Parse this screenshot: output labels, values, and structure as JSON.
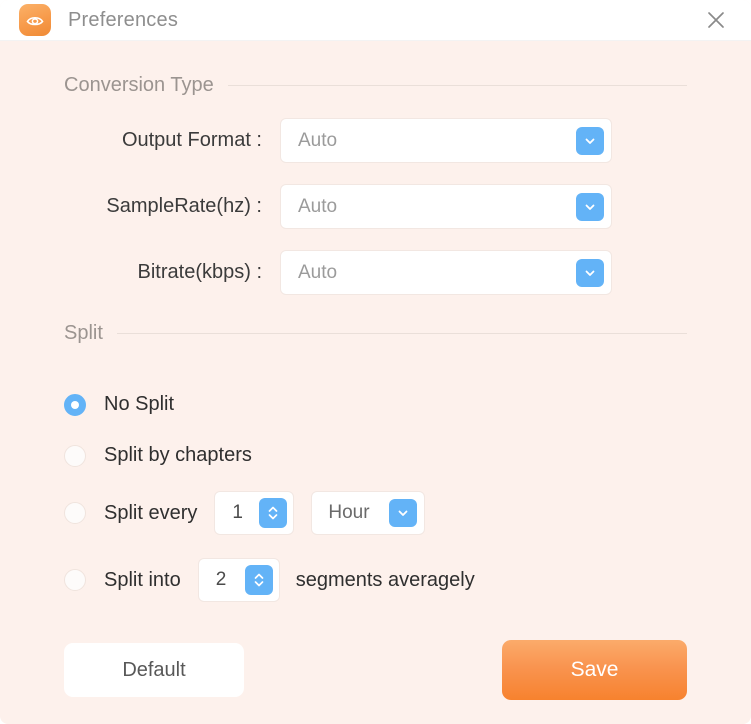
{
  "window": {
    "title": "Preferences",
    "app_icon": "eye-icon",
    "close_icon": "close-icon",
    "background_color": "#FDF1EC",
    "accent_blue": "#63B3F7",
    "accent_orange": "#F7822E"
  },
  "conversion_section": {
    "title": "Conversion Type",
    "rows": [
      {
        "label": "Output Format :",
        "value": "Auto",
        "icon": "chevron-down-icon"
      },
      {
        "label": "SampleRate(hz) :",
        "value": "Auto",
        "icon": "chevron-down-icon"
      },
      {
        "label": "Bitrate(kbps) :",
        "value": "Auto",
        "icon": "chevron-down-icon"
      }
    ]
  },
  "split_section": {
    "title": "Split",
    "options": [
      {
        "label": "No Split",
        "selected": true
      },
      {
        "label": "Split by chapters",
        "selected": false
      },
      {
        "label": "Split every",
        "selected": false
      },
      {
        "label": "Split into",
        "selected": false
      }
    ],
    "split_every": {
      "label": "Split every",
      "amount": "1",
      "spinner_icon": "updown-chevrons-icon",
      "unit": "Hour",
      "unit_icon": "chevron-down-icon"
    },
    "split_into": {
      "label": "Split into",
      "amount": "2",
      "spinner_icon": "updown-chevrons-icon",
      "suffix": "segments averagely"
    }
  },
  "footer": {
    "default_label": "Default",
    "save_label": "Save"
  }
}
